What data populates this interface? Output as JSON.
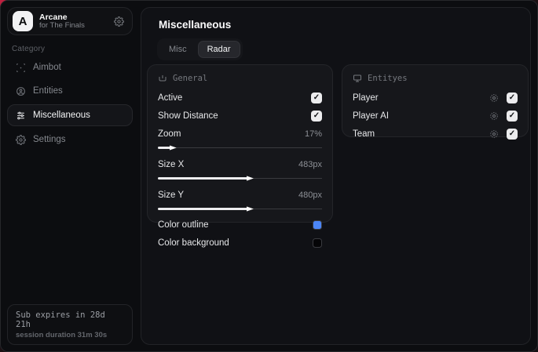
{
  "window": {
    "backdrop_accent": "#c12040",
    "surface": "#0c0d10",
    "panel": "#16171b"
  },
  "sidebar": {
    "app": {
      "logo_letter": "A",
      "name": "Arcane",
      "subtitle": "for The Finals"
    },
    "category_label": "Category",
    "items": [
      {
        "label": "Aimbot",
        "icon": "crosshair-icon",
        "active": false
      },
      {
        "label": "Entities",
        "icon": "entities-icon",
        "active": false
      },
      {
        "label": "Miscellaneous",
        "icon": "sliders-icon",
        "active": true
      },
      {
        "label": "Settings",
        "icon": "gear-icon",
        "active": false
      }
    ],
    "footer": {
      "line1": "Sub expires in 28d 21h",
      "line2": "session duration 31m 30s"
    }
  },
  "main": {
    "title": "Miscellaneous",
    "tabs": [
      {
        "label": "Misc",
        "active": false
      },
      {
        "label": "Radar",
        "active": true
      }
    ],
    "general": {
      "title": "General",
      "active": {
        "label": "Active",
        "checked": true,
        "check_glyph": "✓"
      },
      "show_distance": {
        "label": "Show Distance",
        "checked": true,
        "check_glyph": "✓"
      },
      "zoom": {
        "label": "Zoom",
        "value": "17%",
        "percent": 8
      },
      "size_x": {
        "label": "Size X",
        "value": "483px",
        "percent": 55
      },
      "size_y": {
        "label": "Size Y",
        "value": "480px",
        "percent": 55
      },
      "color_outline": {
        "label": "Color outline",
        "color": "#4b86f7"
      },
      "color_background": {
        "label": "Color background",
        "color": "#050507"
      }
    },
    "entities": {
      "title": "Entityes",
      "rows": [
        {
          "label": "Player",
          "checked": true,
          "check_glyph": "✓"
        },
        {
          "label": "Player AI",
          "checked": true,
          "check_glyph": "✓"
        },
        {
          "label": "Team",
          "checked": true,
          "check_glyph": "✓"
        }
      ]
    }
  }
}
